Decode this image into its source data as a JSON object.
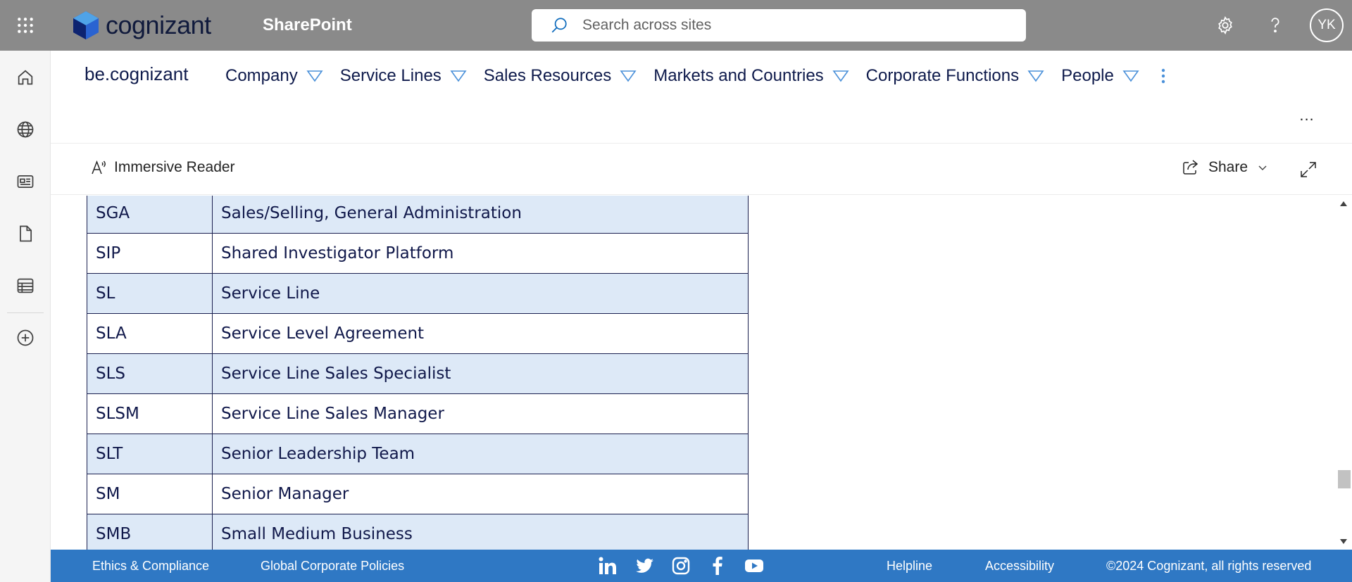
{
  "suite_bar": {
    "brand": "cognizant",
    "app_name": "SharePoint",
    "search_placeholder": "Search across sites",
    "avatar_initials": "YK",
    "background": "#8a8a8a"
  },
  "site": {
    "title": "be.cognizant",
    "nav": [
      {
        "label": "Company"
      },
      {
        "label": "Service Lines"
      },
      {
        "label": "Sales Resources"
      },
      {
        "label": "Markets and Countries"
      },
      {
        "label": "Corporate Functions"
      },
      {
        "label": "People"
      }
    ],
    "overflow_label": "..."
  },
  "command_bar": {
    "immersive_reader": "Immersive Reader",
    "share": "Share"
  },
  "table": {
    "rows": [
      {
        "abbr": "SGA",
        "meaning": "Sales/Selling, General Administration"
      },
      {
        "abbr": "SIP",
        "meaning": "Shared Investigator Platform"
      },
      {
        "abbr": "SL",
        "meaning": "Service Line"
      },
      {
        "abbr": "SLA",
        "meaning": "Service Level Agreement"
      },
      {
        "abbr": "SLS",
        "meaning": "Service Line Sales Specialist"
      },
      {
        "abbr": "SLSM",
        "meaning": "Service Line Sales Manager"
      },
      {
        "abbr": "SLT",
        "meaning": "Senior Leadership Team"
      },
      {
        "abbr": "SM",
        "meaning": "Senior Manager"
      },
      {
        "abbr": "SMB",
        "meaning": "Small Medium Business"
      }
    ],
    "shaded_color": "#dde9f7"
  },
  "footer": {
    "ethics": "Ethics & Compliance",
    "policies": "Global Corporate Policies",
    "helpline": "Helpline",
    "accessibility": "Accessibility",
    "copyright": "©2024 Cognizant, all rights reserved",
    "social": [
      "linkedin-icon",
      "twitter-icon",
      "instagram-icon",
      "facebook-icon",
      "youtube-icon"
    ],
    "background": "#2f78c4"
  }
}
